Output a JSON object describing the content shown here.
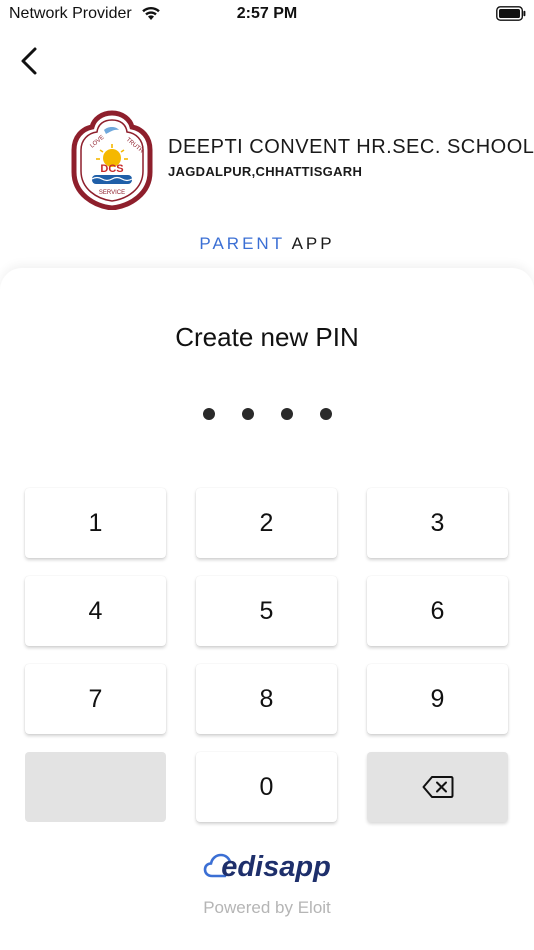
{
  "status_bar": {
    "carrier": "Network Provider",
    "time": "2:57 PM"
  },
  "header": {
    "school_name": "DEEPTI CONVENT HR.SEC. SCHOOL",
    "school_location": "JAGDALPUR,CHHATTISGARH",
    "logo_texts": [
      "LOVE",
      "TRUTH",
      "DCS",
      "SERVICE"
    ]
  },
  "app_label": {
    "accent": "PARENT",
    "rest": "APP",
    "accent_color": "#3b6fd4"
  },
  "pin": {
    "title": "Create new PIN",
    "digits_entered": 4
  },
  "keypad": {
    "keys": [
      "1",
      "2",
      "3",
      "4",
      "5",
      "6",
      "7",
      "8",
      "9",
      "",
      "0",
      "backspace"
    ]
  },
  "footer": {
    "brand": "edisapp",
    "powered_by": "Powered by Eloit",
    "brand_color": "#1e2f6b"
  },
  "icons": {
    "back": "chevron-left-icon",
    "backspace": "backspace-icon",
    "wifi": "wifi-icon",
    "battery": "battery-icon",
    "cloud": "cloud-icon"
  }
}
